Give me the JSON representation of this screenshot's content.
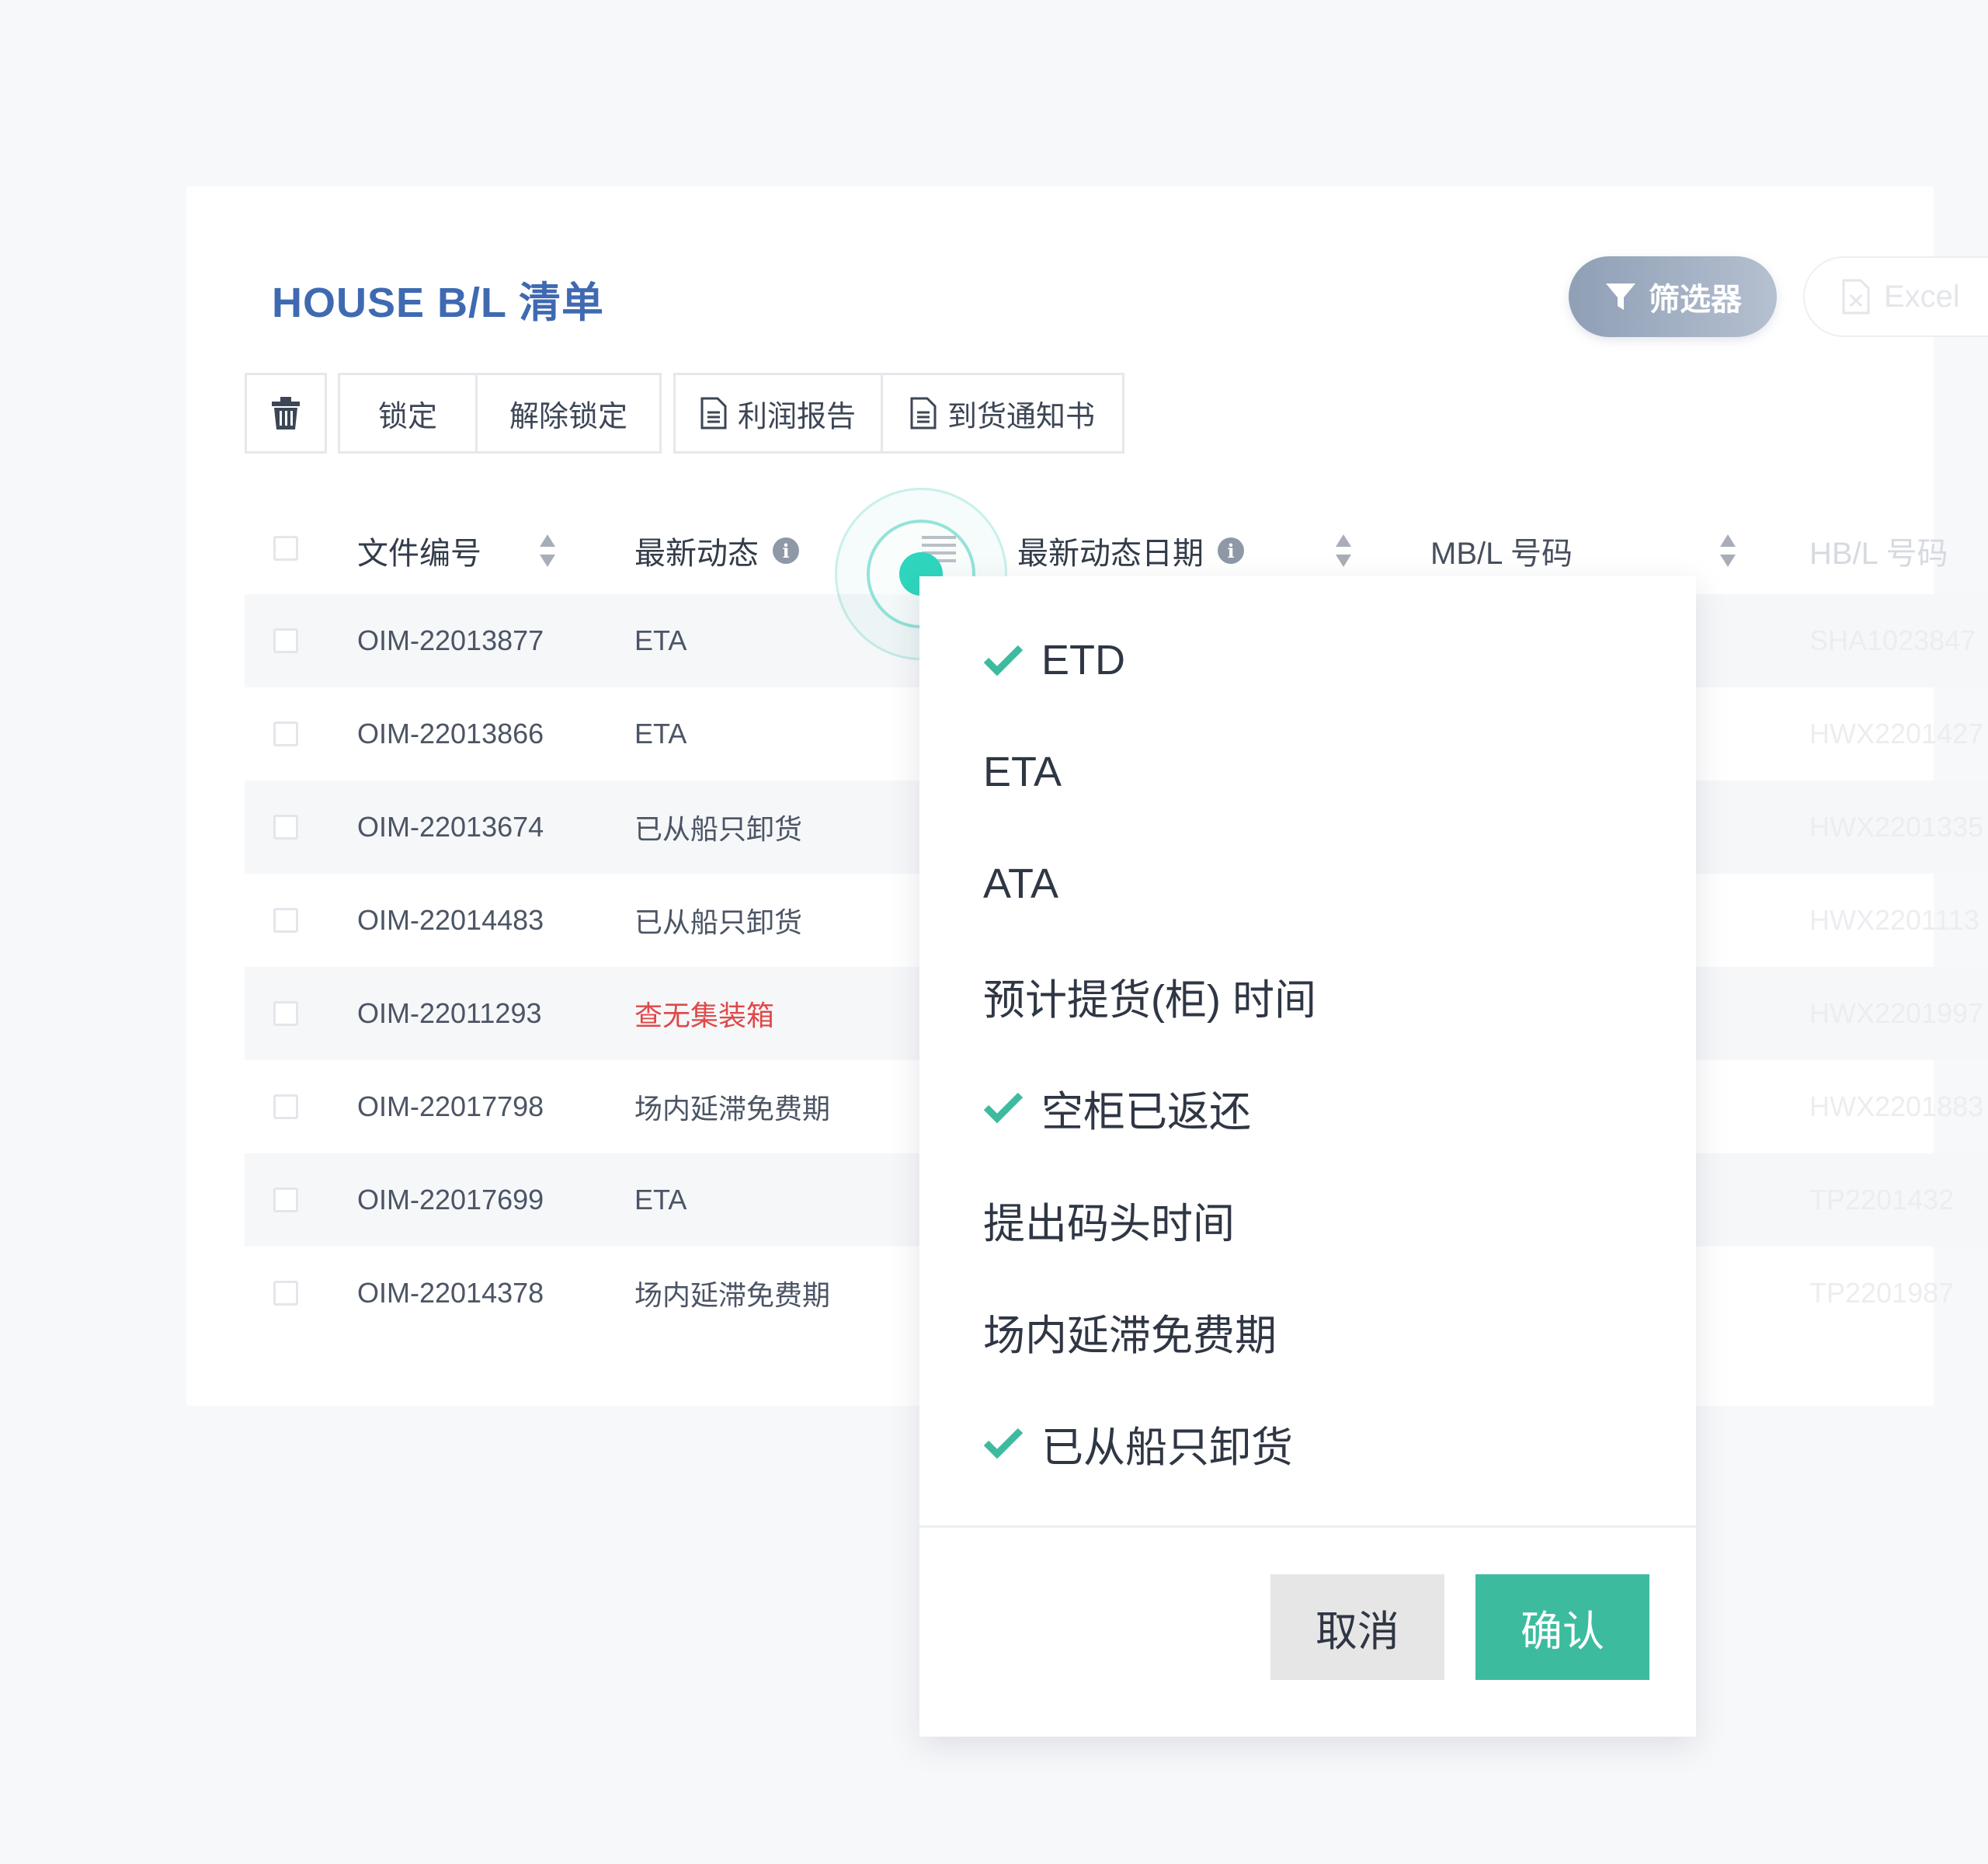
{
  "page": {
    "title": "HOUSE B/L 清单",
    "filter_label": "筛选器",
    "excel_label": "Excel"
  },
  "toolbar": {
    "lock_label": "锁定",
    "unlock_label": "解除锁定",
    "profit_report_label": "利润报告",
    "arrival_notice_label": "到货通知书"
  },
  "table": {
    "columns": {
      "file_no": "文件编号",
      "latest_status": "最新动态",
      "latest_status_date": "最新动态日期",
      "mbl_no": "MB/L 号码",
      "hbl_no": "HB/L 号码"
    },
    "rows": [
      {
        "file_no": "OIM-22013877",
        "status": "ETA",
        "hbl": "SHA1023847"
      },
      {
        "file_no": "OIM-22013866",
        "status": "ETA",
        "hbl": "HWX2201427"
      },
      {
        "file_no": "OIM-22013674",
        "status": "已从船只卸货",
        "hbl": "HWX2201335"
      },
      {
        "file_no": "OIM-22014483",
        "status": "已从船只卸货",
        "hbl": "HWX2201113"
      },
      {
        "file_no": "OIM-22011293",
        "status": "查无集装箱",
        "hbl": "HWX2201997"
      },
      {
        "file_no": "OIM-22017798",
        "status": "场内延滞免费期",
        "hbl": "HWX2201883"
      },
      {
        "file_no": "OIM-22017699",
        "status": "ETA",
        "hbl": "TP2201432"
      },
      {
        "file_no": "OIM-22014378",
        "status": "场内延滞免费期",
        "hbl": "TP2201987"
      }
    ]
  },
  "dropdown": {
    "options": [
      {
        "label": "ETD",
        "checked": true
      },
      {
        "label": "ETA",
        "checked": false
      },
      {
        "label": "ATA",
        "checked": false
      },
      {
        "label": "预计提货(柜) 时间",
        "checked": false
      },
      {
        "label": "空柜已返还",
        "checked": true
      },
      {
        "label": "提出码头时间",
        "checked": false
      },
      {
        "label": "场内延滞免费期",
        "checked": false
      },
      {
        "label": "已从船只卸货",
        "checked": true
      }
    ],
    "cancel_label": "取消",
    "confirm_label": "确认"
  },
  "colors": {
    "accent_teal": "#3dbb9f",
    "title_blue": "#3f6ab1",
    "error_red": "#e04848"
  }
}
